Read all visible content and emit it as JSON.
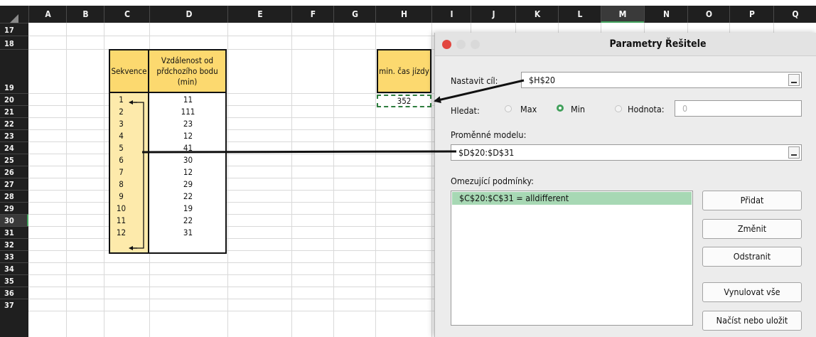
{
  "columns": [
    "A",
    "B",
    "C",
    "D",
    "E",
    "F",
    "G",
    "H",
    "I",
    "J",
    "K",
    "L",
    "M",
    "N",
    "O",
    "P",
    "Q"
  ],
  "active_column": "M",
  "rows": [
    "17",
    "18",
    "19",
    "20",
    "21",
    "22",
    "23",
    "24",
    "25",
    "26",
    "27",
    "28",
    "29",
    "30",
    "31",
    "32",
    "33",
    "34",
    "35",
    "36",
    "37"
  ],
  "active_row": "30",
  "table": {
    "header_seq": "Sekvence",
    "header_dist_line1": "Vzdálenost od",
    "header_dist_line2": "přdchozího bodu",
    "header_dist_line3": "(min)",
    "sequence": [
      "1",
      "2",
      "3",
      "4",
      "5",
      "6",
      "7",
      "8",
      "9",
      "10",
      "11",
      "12"
    ],
    "distances": [
      "11",
      "111",
      "23",
      "12",
      "41",
      "30",
      "12",
      "29",
      "22",
      "19",
      "22",
      "31"
    ]
  },
  "result": {
    "header": "min. čas jízdy",
    "value": "352"
  },
  "dialog": {
    "title": "Parametry Řešitele",
    "set_target_label": "Nastavit cíl:",
    "set_target_value": "$H$20",
    "seek_label": "Hledat:",
    "option_max": "Max",
    "option_min": "Min",
    "option_value": "Hodnota:",
    "value_field": "0",
    "selected_option": "Min",
    "variables_label": "Proměnné modelu:",
    "variables_value": "$D$20:$D$31",
    "constraints_label": "Omezující podmínky:",
    "constraints": [
      "$C$20:$C$31 = alldifferent"
    ],
    "btn_add": "Přidat",
    "btn_change": "Změnit",
    "btn_remove": "Odstranit",
    "btn_reset": "Vynulovat vše",
    "btn_load_save": "Načíst nebo uložit"
  },
  "colors": {
    "header_fill": "#fcd96f",
    "sequence_fill": "#fdeaab",
    "selection_green": "#41a05b",
    "constraint_highlight": "#a7d8b4",
    "close_button": "#e2463f"
  }
}
